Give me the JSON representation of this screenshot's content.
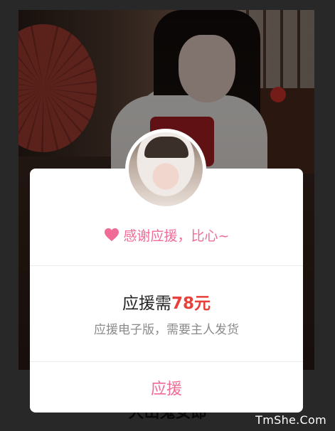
{
  "background": {
    "title_partial": "大山鬼女郎",
    "watermark": "TmShe.Com"
  },
  "dialog": {
    "thanks_text": "感谢应援，比心~",
    "price_prefix": "应援需",
    "price_amount": "78元",
    "subtitle": "应援电子版，需要主人发货",
    "action_label": "应援"
  },
  "colors": {
    "accent_pink": "#f06b95",
    "price_red": "#e8403a"
  },
  "icons": {
    "thanks_icon": "heart-icon"
  }
}
